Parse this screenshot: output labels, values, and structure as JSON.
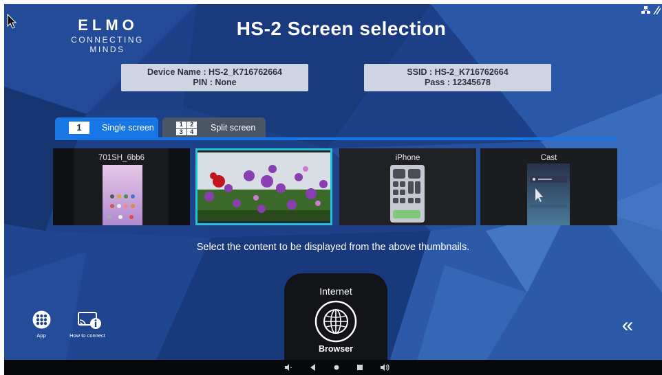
{
  "header": {
    "logo": "ELMO",
    "tagline": "CONNECTING MINDS",
    "title": "HS-2 Screen selection"
  },
  "device_info": {
    "device_name": "Device Name : HS-2_K716762664",
    "pin": "PIN : None"
  },
  "network_info": {
    "ssid": "SSID : HS-2_K716762664",
    "pass": "Pass : 12345678"
  },
  "tabs": [
    {
      "label": "Single screen",
      "badge": "1",
      "active": true
    },
    {
      "label": "Split screen",
      "badge": [
        "1",
        "2",
        "3",
        "4"
      ],
      "active": false
    }
  ],
  "thumbnails": [
    {
      "label": "701SH_6bb6",
      "selected": false
    },
    {
      "label": "",
      "selected": true
    },
    {
      "label": "iPhone",
      "selected": false
    },
    {
      "label": "Cast",
      "selected": false
    }
  ],
  "hint": "Select the content to be displayed from the above thumbnails.",
  "browser": {
    "title": "Internet",
    "label": "Browser"
  },
  "bottom_left": {
    "app_label": "App",
    "connect_label": "How to connect"
  },
  "colors": {
    "background": "#1c3f86",
    "accent": "#1877e6",
    "selected_outline": "#22c3d6",
    "tab_inactive": "#4a5566"
  },
  "icons": {
    "app": "grid-icon",
    "connect": "cast-info-icon",
    "browser": "globe-icon",
    "collapse": "double-chevron-left-icon"
  }
}
